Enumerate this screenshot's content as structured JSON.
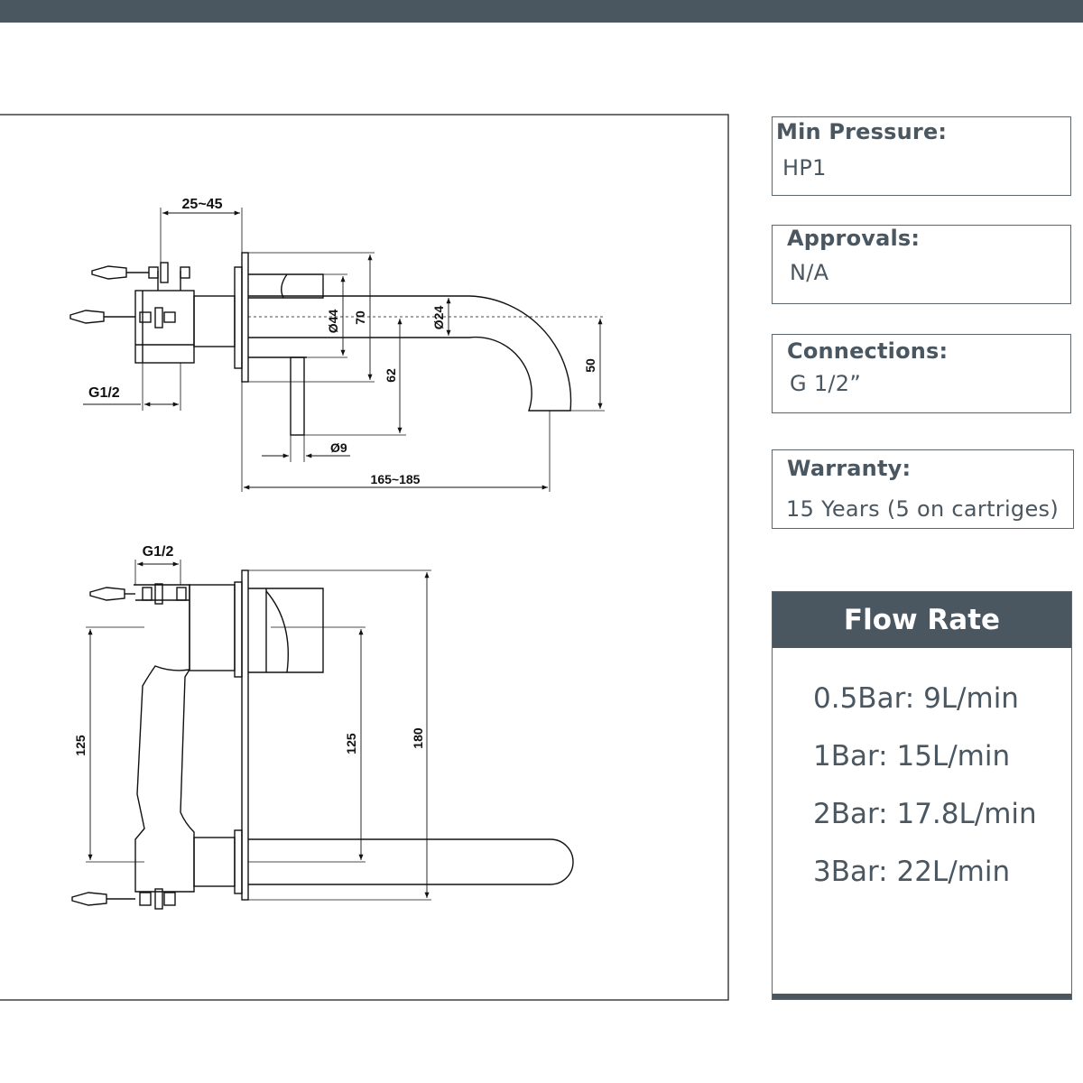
{
  "dimensions": {
    "top": {
      "wall_depth": "25~45",
      "inlet_thread": "G1/2",
      "body_diameter": "Ø44",
      "plate_height": "70",
      "spout_diameter": "Ø24",
      "spout_drop": "50",
      "handle_height": "62",
      "handle_diameter": "Ø9",
      "spout_reach": "165~185"
    },
    "bottom": {
      "inlet_thread": "G1/2",
      "inlet_spacing": "125",
      "center_spacing": "125",
      "plate_length": "180"
    }
  },
  "specs": [
    {
      "label": "Min Pressure:",
      "value": "HP1"
    },
    {
      "label": "Approvals:",
      "value": "N/A"
    },
    {
      "label": "Connections:",
      "value": "G 1/2”"
    },
    {
      "label": "Warranty:",
      "value": "15 Years (5 on cartriges)"
    }
  ],
  "flow_rate": {
    "title": "Flow Rate",
    "items": [
      "0.5Bar: 9L/min",
      "1Bar: 15L/min",
      "2Bar: 17.8L/min",
      "3Bar: 22L/min"
    ]
  },
  "colors": {
    "accent": "#4a5660",
    "line": "#111111"
  }
}
